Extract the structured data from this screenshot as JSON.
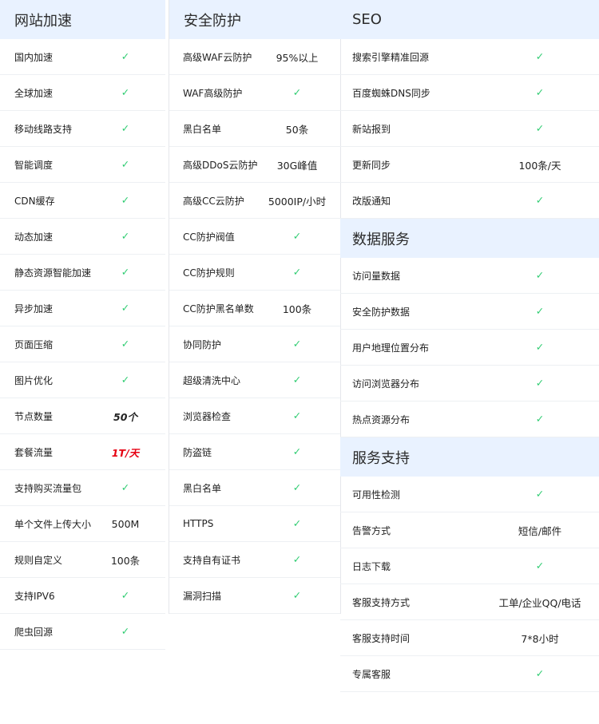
{
  "colors": {
    "header_bg": "#e9f2ff",
    "check": "#2ecc71",
    "highlight_red": "#e60012"
  },
  "col1": {
    "title": "网站加速",
    "rows": [
      {
        "name": "国内加速",
        "value": "✓"
      },
      {
        "name": "全球加速",
        "value": "✓"
      },
      {
        "name": "移动线路支持",
        "value": "✓"
      },
      {
        "name": "智能调度",
        "value": "✓"
      },
      {
        "name": "CDN缓存",
        "value": "✓"
      },
      {
        "name": "动态加速",
        "value": "✓"
      },
      {
        "name": "静态资源智能加速",
        "value": "✓"
      },
      {
        "name": "异步加速",
        "value": "✓"
      },
      {
        "name": "页面压缩",
        "value": "✓"
      },
      {
        "name": "图片优化",
        "value": "✓"
      },
      {
        "name": "节点数量",
        "value": "50个"
      },
      {
        "name": "套餐流量",
        "value": "1T/天"
      },
      {
        "name": "支持购买流量包",
        "value": "✓"
      },
      {
        "name": "单个文件上传大小",
        "value": "500M"
      },
      {
        "name": "规则自定义",
        "value": "100条"
      },
      {
        "name": "支持IPV6",
        "value": "✓"
      },
      {
        "name": "爬虫回源",
        "value": "✓"
      }
    ]
  },
  "col2": {
    "title": "安全防护",
    "rows": [
      {
        "name": "高级WAF云防护",
        "value": "95%以上"
      },
      {
        "name": "WAF高级防护",
        "value": "✓"
      },
      {
        "name": "黑白名单",
        "value": "50条"
      },
      {
        "name": "高级DDoS云防护",
        "value": "30G峰值"
      },
      {
        "name": "高级CC云防护",
        "value": "5000IP/小时"
      },
      {
        "name": "CC防护阀值",
        "value": "✓"
      },
      {
        "name": "CC防护规则",
        "value": "✓"
      },
      {
        "name": "CC防护黑名单数",
        "value": "100条"
      },
      {
        "name": "协同防护",
        "value": "✓"
      },
      {
        "name": "超级清洗中心",
        "value": "✓"
      },
      {
        "name": "浏览器检查",
        "value": "✓"
      },
      {
        "name": "防盗链",
        "value": "✓"
      },
      {
        "name": "黑白名单",
        "value": "✓"
      },
      {
        "name": "HTTPS",
        "value": "✓"
      },
      {
        "name": "支持自有证书",
        "value": "✓"
      },
      {
        "name": "漏洞扫描",
        "value": "✓"
      }
    ]
  },
  "col3": {
    "seo": {
      "title": "SEO",
      "rows": [
        {
          "name": "搜索引擎精准回源",
          "value": "✓"
        },
        {
          "name": "百度蜘蛛DNS同步",
          "value": "✓"
        },
        {
          "name": "新站报到",
          "value": "✓"
        },
        {
          "name": "更新同步",
          "value": "100条/天"
        },
        {
          "name": "改版通知",
          "value": "✓"
        }
      ]
    },
    "data": {
      "title": "数据服务",
      "rows": [
        {
          "name": "访问量数据",
          "value": "✓"
        },
        {
          "name": "安全防护数据",
          "value": "✓"
        },
        {
          "name": "用户地理位置分布",
          "value": "✓"
        },
        {
          "name": "访问浏览器分布",
          "value": "✓"
        },
        {
          "name": "热点资源分布",
          "value": "✓"
        }
      ]
    },
    "support": {
      "title": "服务支持",
      "rows": [
        {
          "name": "可用性检测",
          "value": "✓"
        },
        {
          "name": "告警方式",
          "value": "短信/邮件"
        },
        {
          "name": "日志下载",
          "value": "✓"
        },
        {
          "name": "客服支持方式",
          "value": "工单/企业QQ/电话"
        },
        {
          "name": "客服支持时间",
          "value": "7*8小时"
        },
        {
          "name": "专属客服",
          "value": "✓"
        }
      ]
    }
  }
}
